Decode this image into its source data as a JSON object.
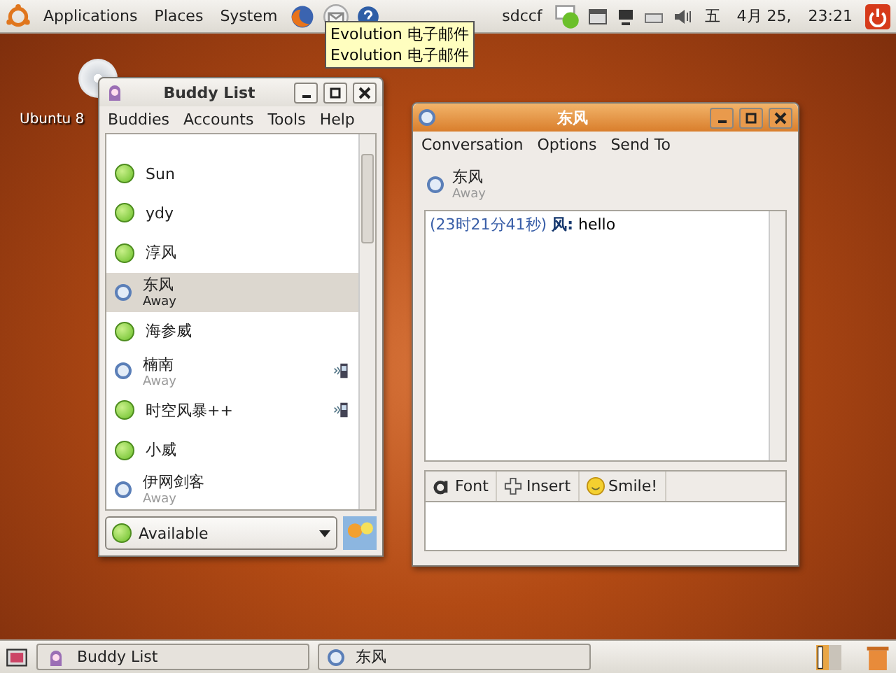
{
  "top_panel": {
    "menus": [
      "Applications",
      "Places",
      "System"
    ],
    "user": "sdccf",
    "weekday": "五",
    "date": "4月 25,",
    "time": "23:21"
  },
  "tooltip": {
    "lines": [
      "Evolution 电子邮件",
      "Evolution 电子邮件"
    ]
  },
  "desktop": {
    "icon_label": "Ubuntu 8"
  },
  "buddy_window": {
    "title": "Buddy List",
    "menus": [
      "Buddies",
      "Accounts",
      "Tools",
      "Help"
    ],
    "buddies": [
      {
        "name": "Sun",
        "kind": "available",
        "selected": false,
        "mobile": false
      },
      {
        "name": "ydy",
        "kind": "available",
        "selected": false,
        "mobile": false
      },
      {
        "name": "淳风",
        "kind": "available",
        "selected": false,
        "mobile": false
      },
      {
        "name": "东风",
        "status": "Away",
        "kind": "away",
        "selected": true,
        "mobile": false
      },
      {
        "name": "海参威",
        "kind": "available",
        "selected": false,
        "mobile": false
      },
      {
        "name": "楠南",
        "status": "Away",
        "kind": "away",
        "selected": false,
        "mobile": true
      },
      {
        "name": "时空风暴++",
        "kind": "available",
        "selected": false,
        "mobile": true
      },
      {
        "name": "小威",
        "kind": "available",
        "selected": false,
        "mobile": false
      },
      {
        "name": "伊网剑客",
        "status": "Away",
        "kind": "away",
        "selected": false,
        "mobile": false
      }
    ],
    "status": "Available"
  },
  "conversation_window": {
    "title": "东风",
    "menus": [
      "Conversation",
      "Options",
      "Send To"
    ],
    "contact": "东风",
    "contact_status": "Away",
    "messages": [
      {
        "stamp": "(23时21分41秒)",
        "sender": "风:",
        "text": "hello"
      }
    ],
    "toolbar": [
      "Font",
      "Insert",
      "Smile!"
    ]
  },
  "taskbar": [
    {
      "label": "Buddy List",
      "kind": "buddy"
    },
    {
      "label": "东风",
      "kind": "away"
    }
  ]
}
